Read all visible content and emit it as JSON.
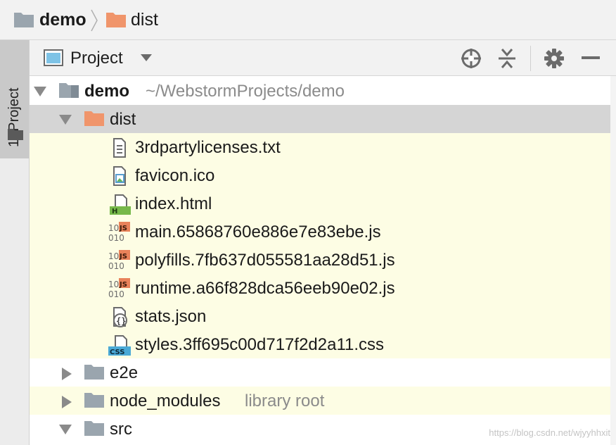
{
  "breadcrumb": {
    "root": "demo",
    "child": "dist"
  },
  "side_panel": {
    "tab_label": "1: Project"
  },
  "toolbar": {
    "title": "Project",
    "icons": [
      "target-icon",
      "collapse-all-icon",
      "gear-icon",
      "minimize-icon",
      "chevron-down-icon"
    ]
  },
  "tree": {
    "project": {
      "name": "demo",
      "path": "~/WebstormProjects/demo"
    },
    "dist": {
      "name": "dist"
    },
    "files": [
      {
        "name": "3rdpartylicenses.txt",
        "type": "text"
      },
      {
        "name": "favicon.ico",
        "type": "image"
      },
      {
        "name": "index.html",
        "type": "html"
      },
      {
        "name": "main.65868760e886e7e83ebe.js",
        "type": "js"
      },
      {
        "name": "polyfills.7fb637d055581aa28d51.js",
        "type": "js"
      },
      {
        "name": "runtime.a66f828dca56eeb90e02.js",
        "type": "js"
      },
      {
        "name": "stats.json",
        "type": "json"
      },
      {
        "name": "styles.3ff695c00d717f2d2a11.css",
        "type": "css"
      }
    ],
    "e2e": {
      "name": "e2e"
    },
    "node_modules": {
      "name": "node_modules",
      "note": "library root"
    },
    "src": {
      "name": "src"
    }
  },
  "colors": {
    "folder_gray": "#9aa5ae",
    "folder_orange": "#f0956b",
    "selection": "#d5d5d5",
    "highlight": "#fdfde4"
  },
  "watermark": "https://blog.csdn.net/wjyyhhxit"
}
